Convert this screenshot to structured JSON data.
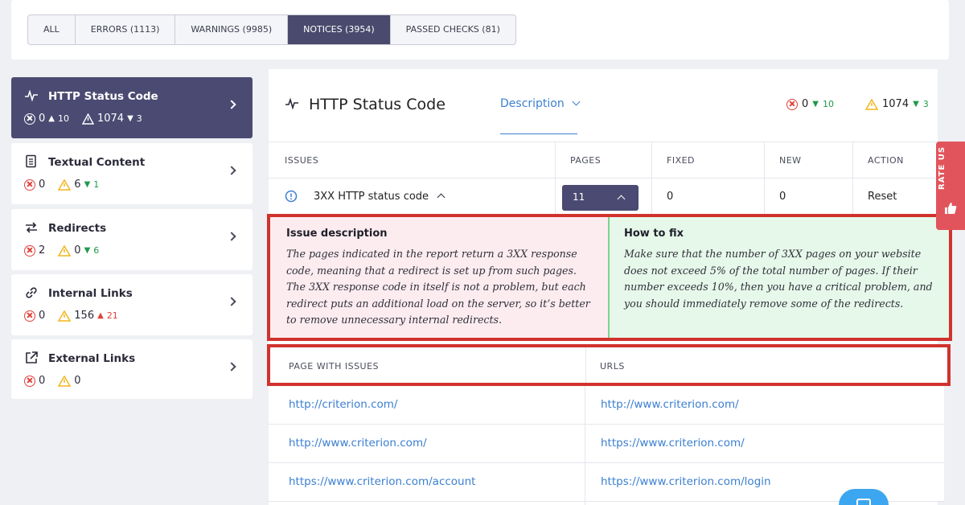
{
  "filter_tabs": [
    {
      "label": "ALL",
      "active": false
    },
    {
      "label": "ERRORS (1113)",
      "active": false
    },
    {
      "label": "WARNINGS (9985)",
      "active": false
    },
    {
      "label": "NOTICES (3954)",
      "active": true
    },
    {
      "label": "PASSED CHECKS (81)",
      "active": false
    }
  ],
  "sidebar": {
    "items": [
      {
        "title": "HTTP Status Code",
        "icon": "pulse-icon",
        "errors": "0",
        "errors_delta": "10",
        "warnings": "1074",
        "warnings_delta": "3",
        "active": true
      },
      {
        "title": "Textual Content",
        "icon": "document-icon",
        "errors": "0",
        "errors_delta": "",
        "warnings": "6",
        "warnings_delta": "1",
        "active": false
      },
      {
        "title": "Redirects",
        "icon": "redirect-icon",
        "errors": "2",
        "errors_delta": "",
        "warnings": "0",
        "warnings_delta": "6",
        "active": false
      },
      {
        "title": "Internal Links",
        "icon": "link-icon",
        "errors": "0",
        "errors_delta": "",
        "warnings": "156",
        "warnings_delta": "21",
        "active": false
      },
      {
        "title": "External Links",
        "icon": "external-link-icon",
        "errors": "0",
        "errors_delta": "",
        "warnings": "0",
        "warnings_delta": "",
        "active": false
      }
    ]
  },
  "panel": {
    "title": "HTTP Status Code",
    "description_label": "Description",
    "errors": "0",
    "errors_delta": "10",
    "warnings": "1074",
    "warnings_delta": "3"
  },
  "table": {
    "headers": {
      "issues": "ISSUES",
      "pages": "PAGES",
      "fixed": "FIXED",
      "new": "NEW",
      "action": "ACTION"
    },
    "row": {
      "issue": "3XX HTTP status code",
      "pages": "11",
      "fixed": "0",
      "new": "0",
      "action": "Reset"
    }
  },
  "issue_description": {
    "heading": "Issue description",
    "text": "The pages indicated in the report return a 3XX response code, meaning that a redirect is set up from such pages. The 3XX response code in itself is not a problem, but each redirect puts an additional load on the server, so it’s better to remove unnecessary internal redirects."
  },
  "how_to_fix": {
    "heading": "How to fix",
    "text": "Make sure that the number of 3XX pages on your website does not exceed 5% of the total number of pages. If their number exceeds 10%, then you have a critical problem, and you should immediately remove some of the redirects."
  },
  "url_table": {
    "headers": {
      "page": "PAGE WITH ISSUES",
      "urls": "URLS"
    },
    "rows": [
      {
        "page": "http://criterion.com/",
        "url": "http://www.criterion.com/"
      },
      {
        "page": "http://www.criterion.com/",
        "url": "https://www.criterion.com/"
      },
      {
        "page": "https://www.criterion.com/account",
        "url": "https://www.criterion.com/login"
      }
    ]
  },
  "rate_us": {
    "label": "RATE US"
  },
  "colors": {
    "accent": "#4b4a72",
    "link": "#3b7fd1",
    "error": "#e0413b",
    "warning": "#f2b51d",
    "success": "#1f9a4a",
    "highlight": "#d1322d"
  }
}
